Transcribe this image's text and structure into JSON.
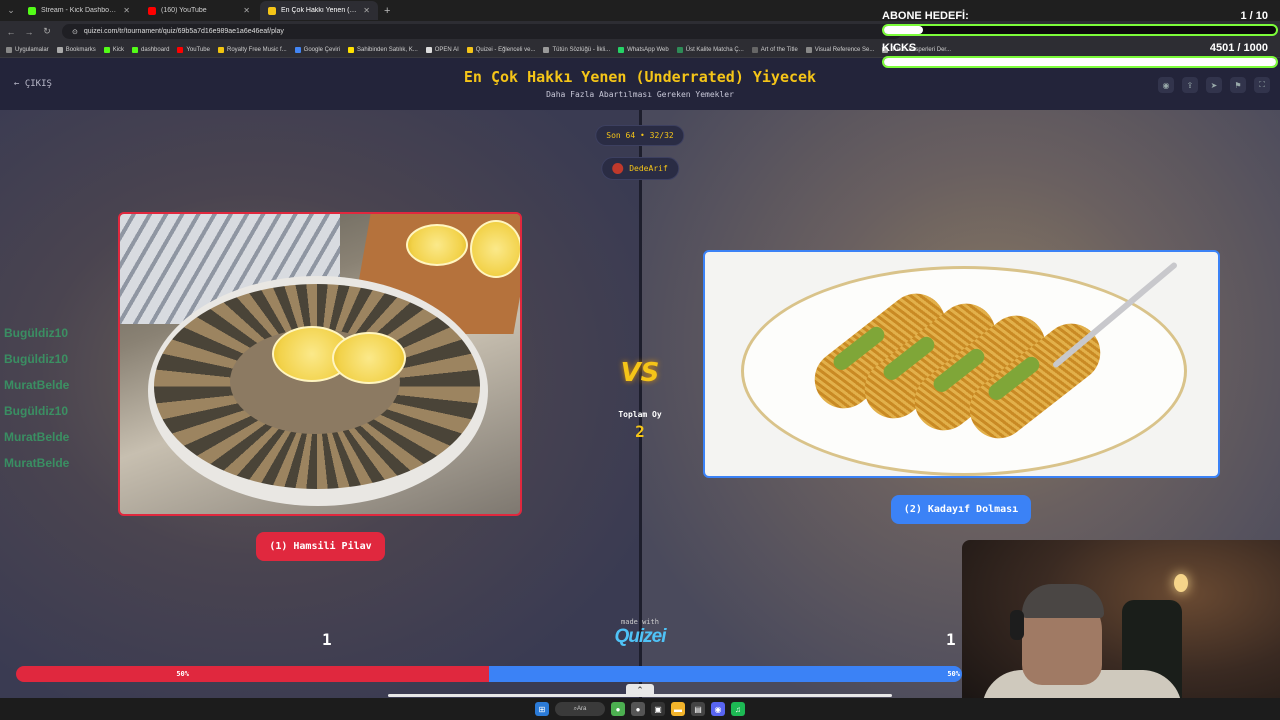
{
  "browser": {
    "tabs": [
      {
        "label": "Stream - Kick Dashboard",
        "color": "#53fc18"
      },
      {
        "label": "(160) YouTube",
        "color": "#ff0000"
      },
      {
        "label": "En Çok Hakkı Yenen (Underrated)",
        "color": "#f5c518"
      }
    ],
    "url": "quizei.com/tr/tournament/quiz/69b5a7d16e989ae1a6e46eaf/play",
    "bookmarks": [
      "Uygulamalar",
      "Bookmarks",
      "Kick",
      "dashboard",
      "YouTube",
      "Royalty Free Music f...",
      "Google Çeviri",
      "Sahibinden Satılık, K...",
      "OPEN AI",
      "Quizei - Eğlenceli ve...",
      "Tütün Sözlüğü - İlkli...",
      "WhatsApp Web",
      "Üst Kalite Matcha Ç...",
      "Art of the Title",
      "Visual Reference Se...",
      "Tütün Eksperleri Der..."
    ]
  },
  "quiz": {
    "exit_label": "ÇIKIŞ",
    "title": "En Çok Hakkı Yenen (Underrated) Yiyecek",
    "subtitle": "Daha Fazla Abartılması Gereken Yemekler",
    "round": "Son 64 • 32/32",
    "username": "DedeArif",
    "vs": "VS",
    "total_label": "Toplam Oy",
    "total_votes": "2",
    "made_with": "made with",
    "brand": "Quizei",
    "left": {
      "label": "(1) Hamsili Pilav",
      "votes": "1",
      "percent_label": "50%"
    },
    "right": {
      "label": "(2) Kadayıf Dolması",
      "votes": "1",
      "percent_label": "50%"
    },
    "left_share": 0.5,
    "left_color": "#e0283e",
    "right_color": "#3b82f6"
  },
  "chat_overlay": [
    "Bugüldiz10",
    "Bugüldiz10",
    "MuratBelde",
    "Bugüldiz10",
    "MuratBelde",
    "MuratBelde"
  ],
  "stream_overlay": {
    "sub_goal_label": "ABONE HEDEFİ:",
    "sub_goal_value": "1 / 10",
    "sub_goal_progress": 0.1,
    "kicks_label": "KICKS",
    "kicks_value": "4501 / 1000",
    "kicks_progress": 1.0
  },
  "taskbar": {
    "search_label": "Ara"
  }
}
